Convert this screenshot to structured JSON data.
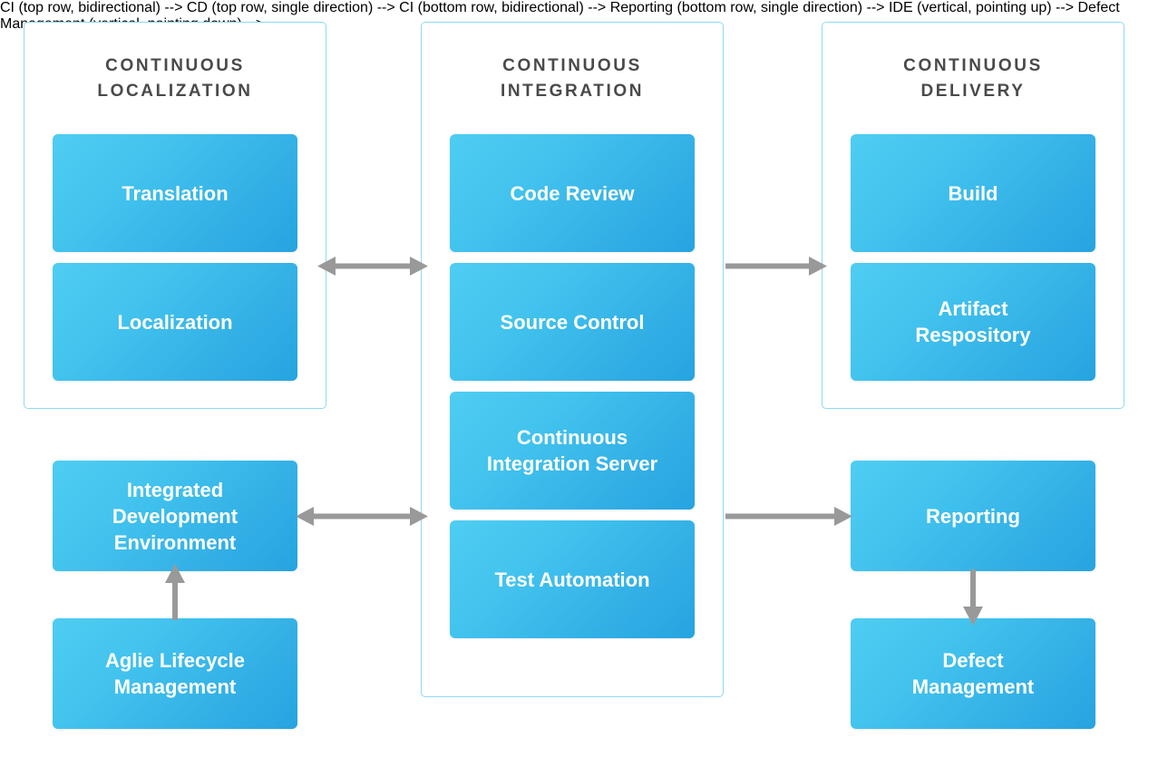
{
  "diagram": {
    "title_accessible": "Continuous Localization, Continuous Integration and Continuous Delivery pipeline",
    "colors": {
      "panel_border": "#8ed8f8",
      "node_gradient_start": "#4fcdf2",
      "node_gradient_end": "#26a4e0",
      "node_text": "#ffffff",
      "panel_title_text": "#4a4a4a",
      "arrow": "#999999",
      "background": "#ffffff"
    },
    "panels": [
      {
        "id": "continuous-localization",
        "title": "CONTINUOUS\nLOCALIZATION",
        "nodes": [
          {
            "id": "translation",
            "label": "Translation"
          },
          {
            "id": "localization",
            "label": "Localization"
          }
        ]
      },
      {
        "id": "continuous-integration",
        "title": "CONTINUOUS\nINTEGRATION",
        "nodes": [
          {
            "id": "code-review",
            "label": "Code Review"
          },
          {
            "id": "source-control",
            "label": "Source Control"
          },
          {
            "id": "continuous-integration-server",
            "label": "Continuous\nIntegration Server"
          },
          {
            "id": "test-automation",
            "label": "Test Automation"
          }
        ]
      },
      {
        "id": "continuous-delivery",
        "title": "CONTINUOUS\nDELIVERY",
        "nodes": [
          {
            "id": "build",
            "label": "Build"
          },
          {
            "id": "artifact-repository",
            "label": "Artifact\nRespository"
          }
        ]
      }
    ],
    "standalone_nodes": [
      {
        "id": "integrated-development-environment",
        "label": "Integrated\nDevelopment\nEnvironment"
      },
      {
        "id": "agile-lifecycle-management",
        "label": "Aglie Lifecycle\nManagement"
      },
      {
        "id": "reporting",
        "label": "Reporting"
      },
      {
        "id": "defect-management",
        "label": "Defect\nManagement"
      }
    ],
    "connectors": [
      {
        "id": "cl-to-ci",
        "from": "continuous-localization",
        "to": "continuous-integration",
        "direction": "bidirectional",
        "orientation": "horizontal"
      },
      {
        "id": "ci-to-cd",
        "from": "continuous-integration",
        "to": "continuous-delivery",
        "direction": "forward",
        "orientation": "horizontal"
      },
      {
        "id": "ide-to-ci",
        "from": "integrated-development-environment",
        "to": "continuous-integration",
        "direction": "bidirectional",
        "orientation": "horizontal"
      },
      {
        "id": "ci-to-reporting",
        "from": "continuous-integration",
        "to": "reporting",
        "direction": "forward",
        "orientation": "horizontal"
      },
      {
        "id": "alm-to-ide",
        "from": "agile-lifecycle-management",
        "to": "integrated-development-environment",
        "direction": "forward",
        "orientation": "vertical-up"
      },
      {
        "id": "reporting-to-defect",
        "from": "reporting",
        "to": "defect-management",
        "direction": "forward",
        "orientation": "vertical-down"
      }
    ]
  }
}
